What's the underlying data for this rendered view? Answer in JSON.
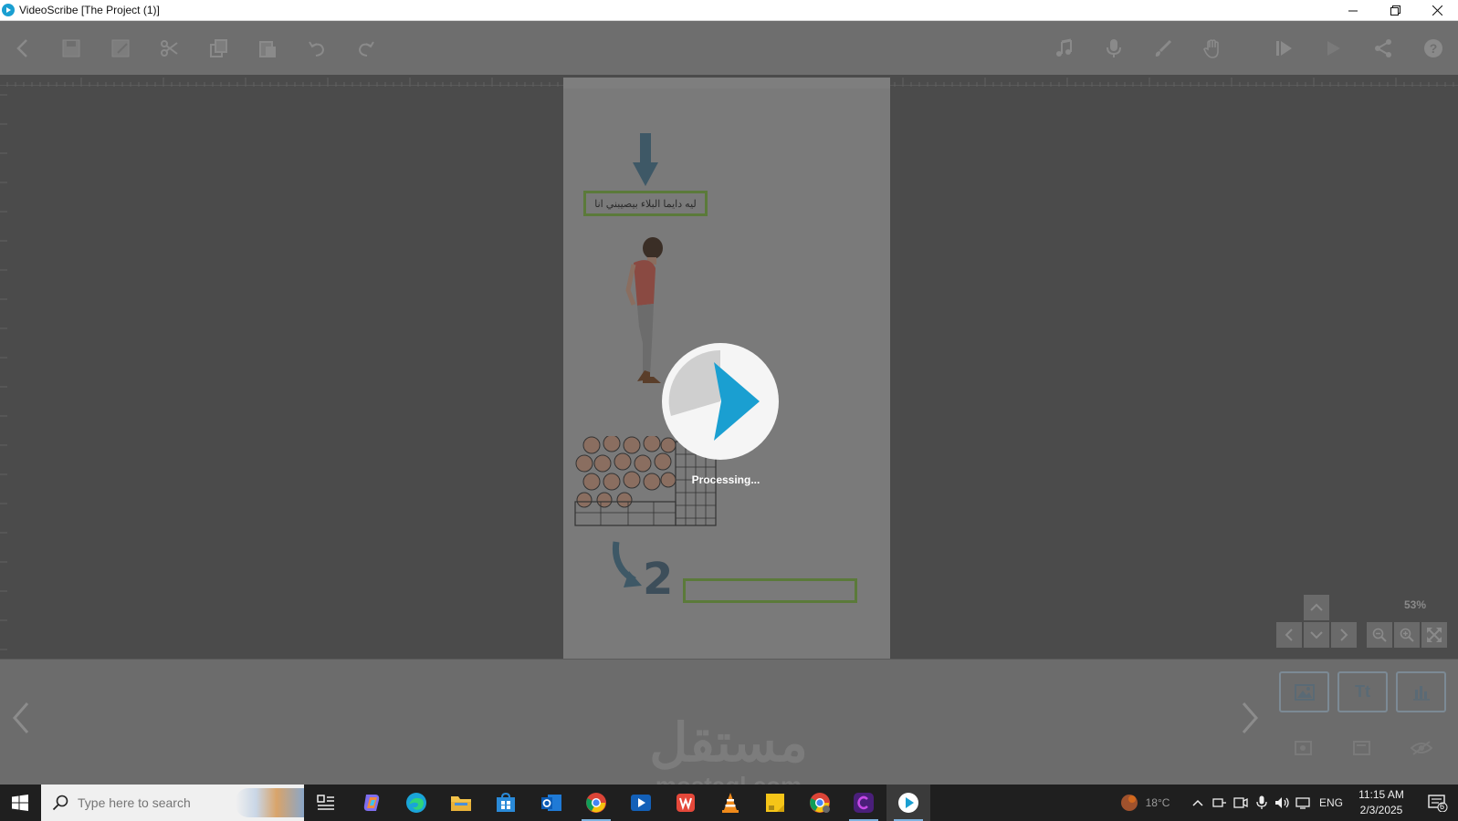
{
  "window": {
    "title": "VideoScribe [The Project (1)]"
  },
  "canvas": {
    "arabic_text": "ليه دايما البلاء بيصيبني انا",
    "number_label": "2",
    "processing_text": "Processing...",
    "zoom_level": "53%"
  },
  "watermark": {
    "text": "مستقل",
    "sub": "mostaql.com"
  },
  "taskbar": {
    "search_placeholder": "Type here to search",
    "weather": "18°C",
    "language": "ENG",
    "time": "11:15 AM",
    "date": "2/3/2025",
    "notification_count": "6"
  },
  "timeline": {
    "text_button_label": "Tt"
  },
  "colors": {
    "accent": "#1a9fd1",
    "box_green": "#5b7a3a",
    "overlay": "#4a4a4a"
  }
}
